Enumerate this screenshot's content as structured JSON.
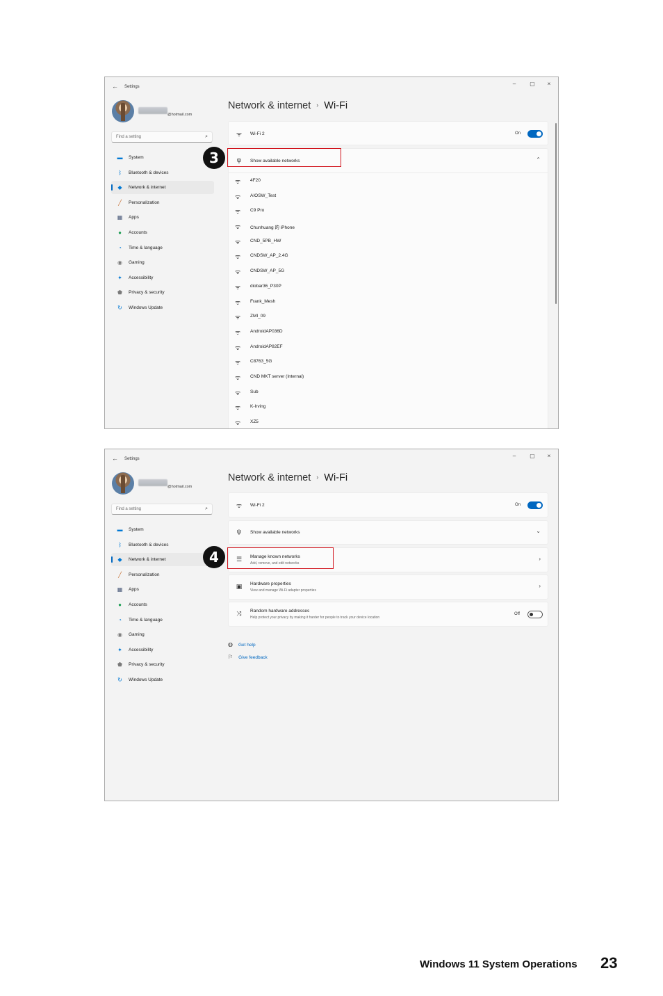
{
  "window_1": {
    "app_title": "Settings",
    "window_controls": {
      "minimize": "–",
      "maximize": "▢",
      "close": "×"
    },
    "account_email": "@hotmail.com",
    "search_placeholder": "Find a setting",
    "nav_items": [
      {
        "label": "System",
        "icon": "system-icon",
        "color": "#0078d4"
      },
      {
        "label": "Bluetooth & devices",
        "icon": "bluetooth-icon",
        "color": "#0078d4"
      },
      {
        "label": "Network & internet",
        "icon": "network-icon",
        "color": "#0078d4",
        "active": true
      },
      {
        "label": "Personalization",
        "icon": "brush-icon",
        "color": "#c46a2b"
      },
      {
        "label": "Apps",
        "icon": "apps-icon",
        "color": "#4a5a7a"
      },
      {
        "label": "Accounts",
        "icon": "accounts-icon",
        "color": "#1f9e55"
      },
      {
        "label": "Time & language",
        "icon": "time-language-icon",
        "color": "#0078d4"
      },
      {
        "label": "Gaming",
        "icon": "gaming-icon",
        "color": "#7a7a7a"
      },
      {
        "label": "Accessibility",
        "icon": "accessibility-icon",
        "color": "#0078d4"
      },
      {
        "label": "Privacy & security",
        "icon": "shield-icon",
        "color": "#7a7a7a"
      },
      {
        "label": "Windows Update",
        "icon": "windows-update-icon",
        "color": "#0078d4"
      }
    ],
    "breadcrumb": {
      "parent": "Network & internet",
      "separator": "›",
      "current": "Wi-Fi"
    },
    "wifi_row": {
      "label": "Wi-Fi 2",
      "toggle_label": "On",
      "toggle_on": true
    },
    "show_networks_label": "Show available networks",
    "networks": [
      "4F20",
      "AIOSW_Test",
      "C9 Pro",
      "Chunhuang 的 iPhone",
      "CND_5PB_HW",
      "CNDSW_AP_2.4G",
      "CNDSW_AP_5G",
      "diobar36_P30P",
      "Frank_Mesh",
      "ZMI_09",
      "AndroidAP036D",
      "AndroidAP82EF",
      "C8763_5G",
      "CND MKT server (Internal)",
      "Sub",
      "K-Irving",
      "XZ5"
    ],
    "callout": "3"
  },
  "window_2": {
    "app_title": "Settings",
    "window_controls": {
      "minimize": "–",
      "maximize": "▢",
      "close": "×"
    },
    "account_email": "@hotmail.com",
    "search_placeholder": "Find a setting",
    "nav_items": [
      {
        "label": "System",
        "icon": "system-icon",
        "color": "#0078d4"
      },
      {
        "label": "Bluetooth & devices",
        "icon": "bluetooth-icon",
        "color": "#0078d4"
      },
      {
        "label": "Network & internet",
        "icon": "network-icon",
        "color": "#0078d4",
        "active": true
      },
      {
        "label": "Personalization",
        "icon": "brush-icon",
        "color": "#c46a2b"
      },
      {
        "label": "Apps",
        "icon": "apps-icon",
        "color": "#4a5a7a"
      },
      {
        "label": "Accounts",
        "icon": "accounts-icon",
        "color": "#1f9e55"
      },
      {
        "label": "Time & language",
        "icon": "time-language-icon",
        "color": "#0078d4"
      },
      {
        "label": "Gaming",
        "icon": "gaming-icon",
        "color": "#7a7a7a"
      },
      {
        "label": "Accessibility",
        "icon": "accessibility-icon",
        "color": "#0078d4"
      },
      {
        "label": "Privacy & security",
        "icon": "shield-icon",
        "color": "#7a7a7a"
      },
      {
        "label": "Windows Update",
        "icon": "windows-update-icon",
        "color": "#0078d4"
      }
    ],
    "breadcrumb": {
      "parent": "Network & internet",
      "separator": "›",
      "current": "Wi-Fi"
    },
    "wifi_row": {
      "label": "Wi-Fi 2",
      "toggle_label": "On",
      "toggle_on": true
    },
    "show_networks_label": "Show available networks",
    "manage_known": {
      "title": "Manage known networks",
      "subtitle": "Add, remove, and edit networks"
    },
    "hardware_props": {
      "title": "Hardware properties",
      "subtitle": "View and manage Wi-Fi adapter properties"
    },
    "random_hw": {
      "title": "Random hardware addresses",
      "subtitle": "Help protect your privacy by making it harder for people to track your device location",
      "toggle_label": "Off",
      "toggle_on": false
    },
    "get_help": "Get help",
    "give_feedback": "Give feedback",
    "callout": "4"
  },
  "footer": {
    "title": "Windows 11 System Operations",
    "page_number": "23"
  },
  "colors": {
    "accent": "#0067c0",
    "callout_red": "#d1141d",
    "callout_badge": "#111111"
  }
}
